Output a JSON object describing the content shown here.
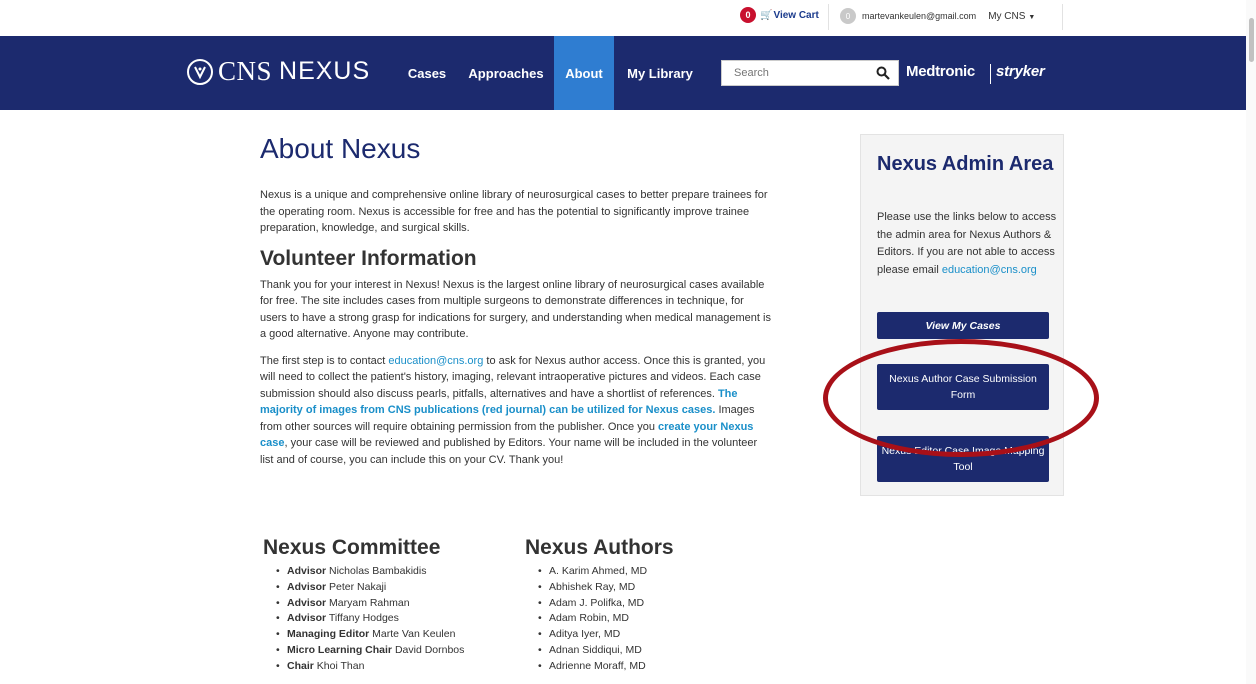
{
  "utility": {
    "cart_count": "0",
    "cart_label": "View Cart",
    "user_initial": "0",
    "user_email": "martevankeulen@gmail.com",
    "mycns_label": "My CNS"
  },
  "nav": {
    "logo_cns": "CNS",
    "logo_nexus": "NEXUS",
    "items": [
      {
        "label": "Cases"
      },
      {
        "label": "Approaches"
      },
      {
        "label": "About",
        "active": true
      },
      {
        "label": "My Library"
      }
    ],
    "search_placeholder": "Search",
    "sponsors": [
      "Medtronic",
      "stryker"
    ]
  },
  "main": {
    "title": "About Nexus",
    "intro": "Nexus is a unique and comprehensive online library of neurosurgical cases to better prepare trainees for the operating room.  Nexus is accessible for free and has the potential to significantly improve trainee preparation, knowledge, and surgical skills.",
    "volunteer_heading": "Volunteer Information",
    "volunteer_p1": "Thank you for your interest in Nexus! Nexus is the largest online library of neurosurgical cases available for free. The site includes cases from multiple surgeons to demonstrate differences in technique, for users to have a strong grasp for indications for surgery, and understanding when medical management is a good alternative. Anyone may contribute.",
    "volunteer_p2_a": "The first step is to contact ",
    "volunteer_p2_email": "education@cns.org",
    "volunteer_p2_b": " to ask for Nexus author access. Once this is granted, you will need to collect the patient's history, imaging, relevant intraoperative pictures and videos. Each case submission should also discuss pearls, pitfalls, alternatives and have a shortlist of references. ",
    "volunteer_p2_link1": "The majority of images from CNS publications (red journal) can be utilized for Nexus cases.",
    "volunteer_p2_c": " Images from other sources will require obtaining permission from the publisher. Once you ",
    "volunteer_p2_link2": "create your Nexus case",
    "volunteer_p2_d": ", your case will be reviewed and published by Editors. Your name will be included in the volunteer list and of course, you can include this on your CV. Thank you!"
  },
  "committee": {
    "heading": "Nexus Committee",
    "members": [
      {
        "role": "Advisor",
        "name": "Nicholas Bambakidis"
      },
      {
        "role": "Advisor",
        "name": "Peter Nakaji"
      },
      {
        "role": "Advisor",
        "name": "Maryam Rahman"
      },
      {
        "role": "Advisor",
        "name": "Tiffany Hodges"
      },
      {
        "role": "Managing Editor",
        "name": "Marte Van Keulen"
      },
      {
        "role": "Micro Learning Chair",
        "name": "David Dornbos"
      },
      {
        "role": "Chair",
        "name": "Khoi Than"
      }
    ]
  },
  "authors": {
    "heading": "Nexus Authors",
    "names": [
      "A. Karim Ahmed, MD",
      "Abhishek Ray, MD",
      "Adam J. Polifka, MD",
      "Adam Robin, MD",
      "Aditya Iyer, MD",
      "Adnan Siddiqui, MD",
      "Adrienne Moraff, MD"
    ]
  },
  "sidebar": {
    "title": "Nexus Admin Area",
    "text": "Please use the links below to access the admin area for Nexus Authors & Editors. If you are not able to access please email ",
    "email": "education@cns.org",
    "btn_view": "View My Cases",
    "btn_author": "Nexus Author Case Submission Form",
    "btn_editor": "Nexus Editor Case Image Mapping Tool"
  },
  "colors": {
    "nav_bg": "#1c2a6e",
    "nav_active": "#2f7dd1",
    "link": "#1a8fc9",
    "annotation": "#a81018"
  }
}
